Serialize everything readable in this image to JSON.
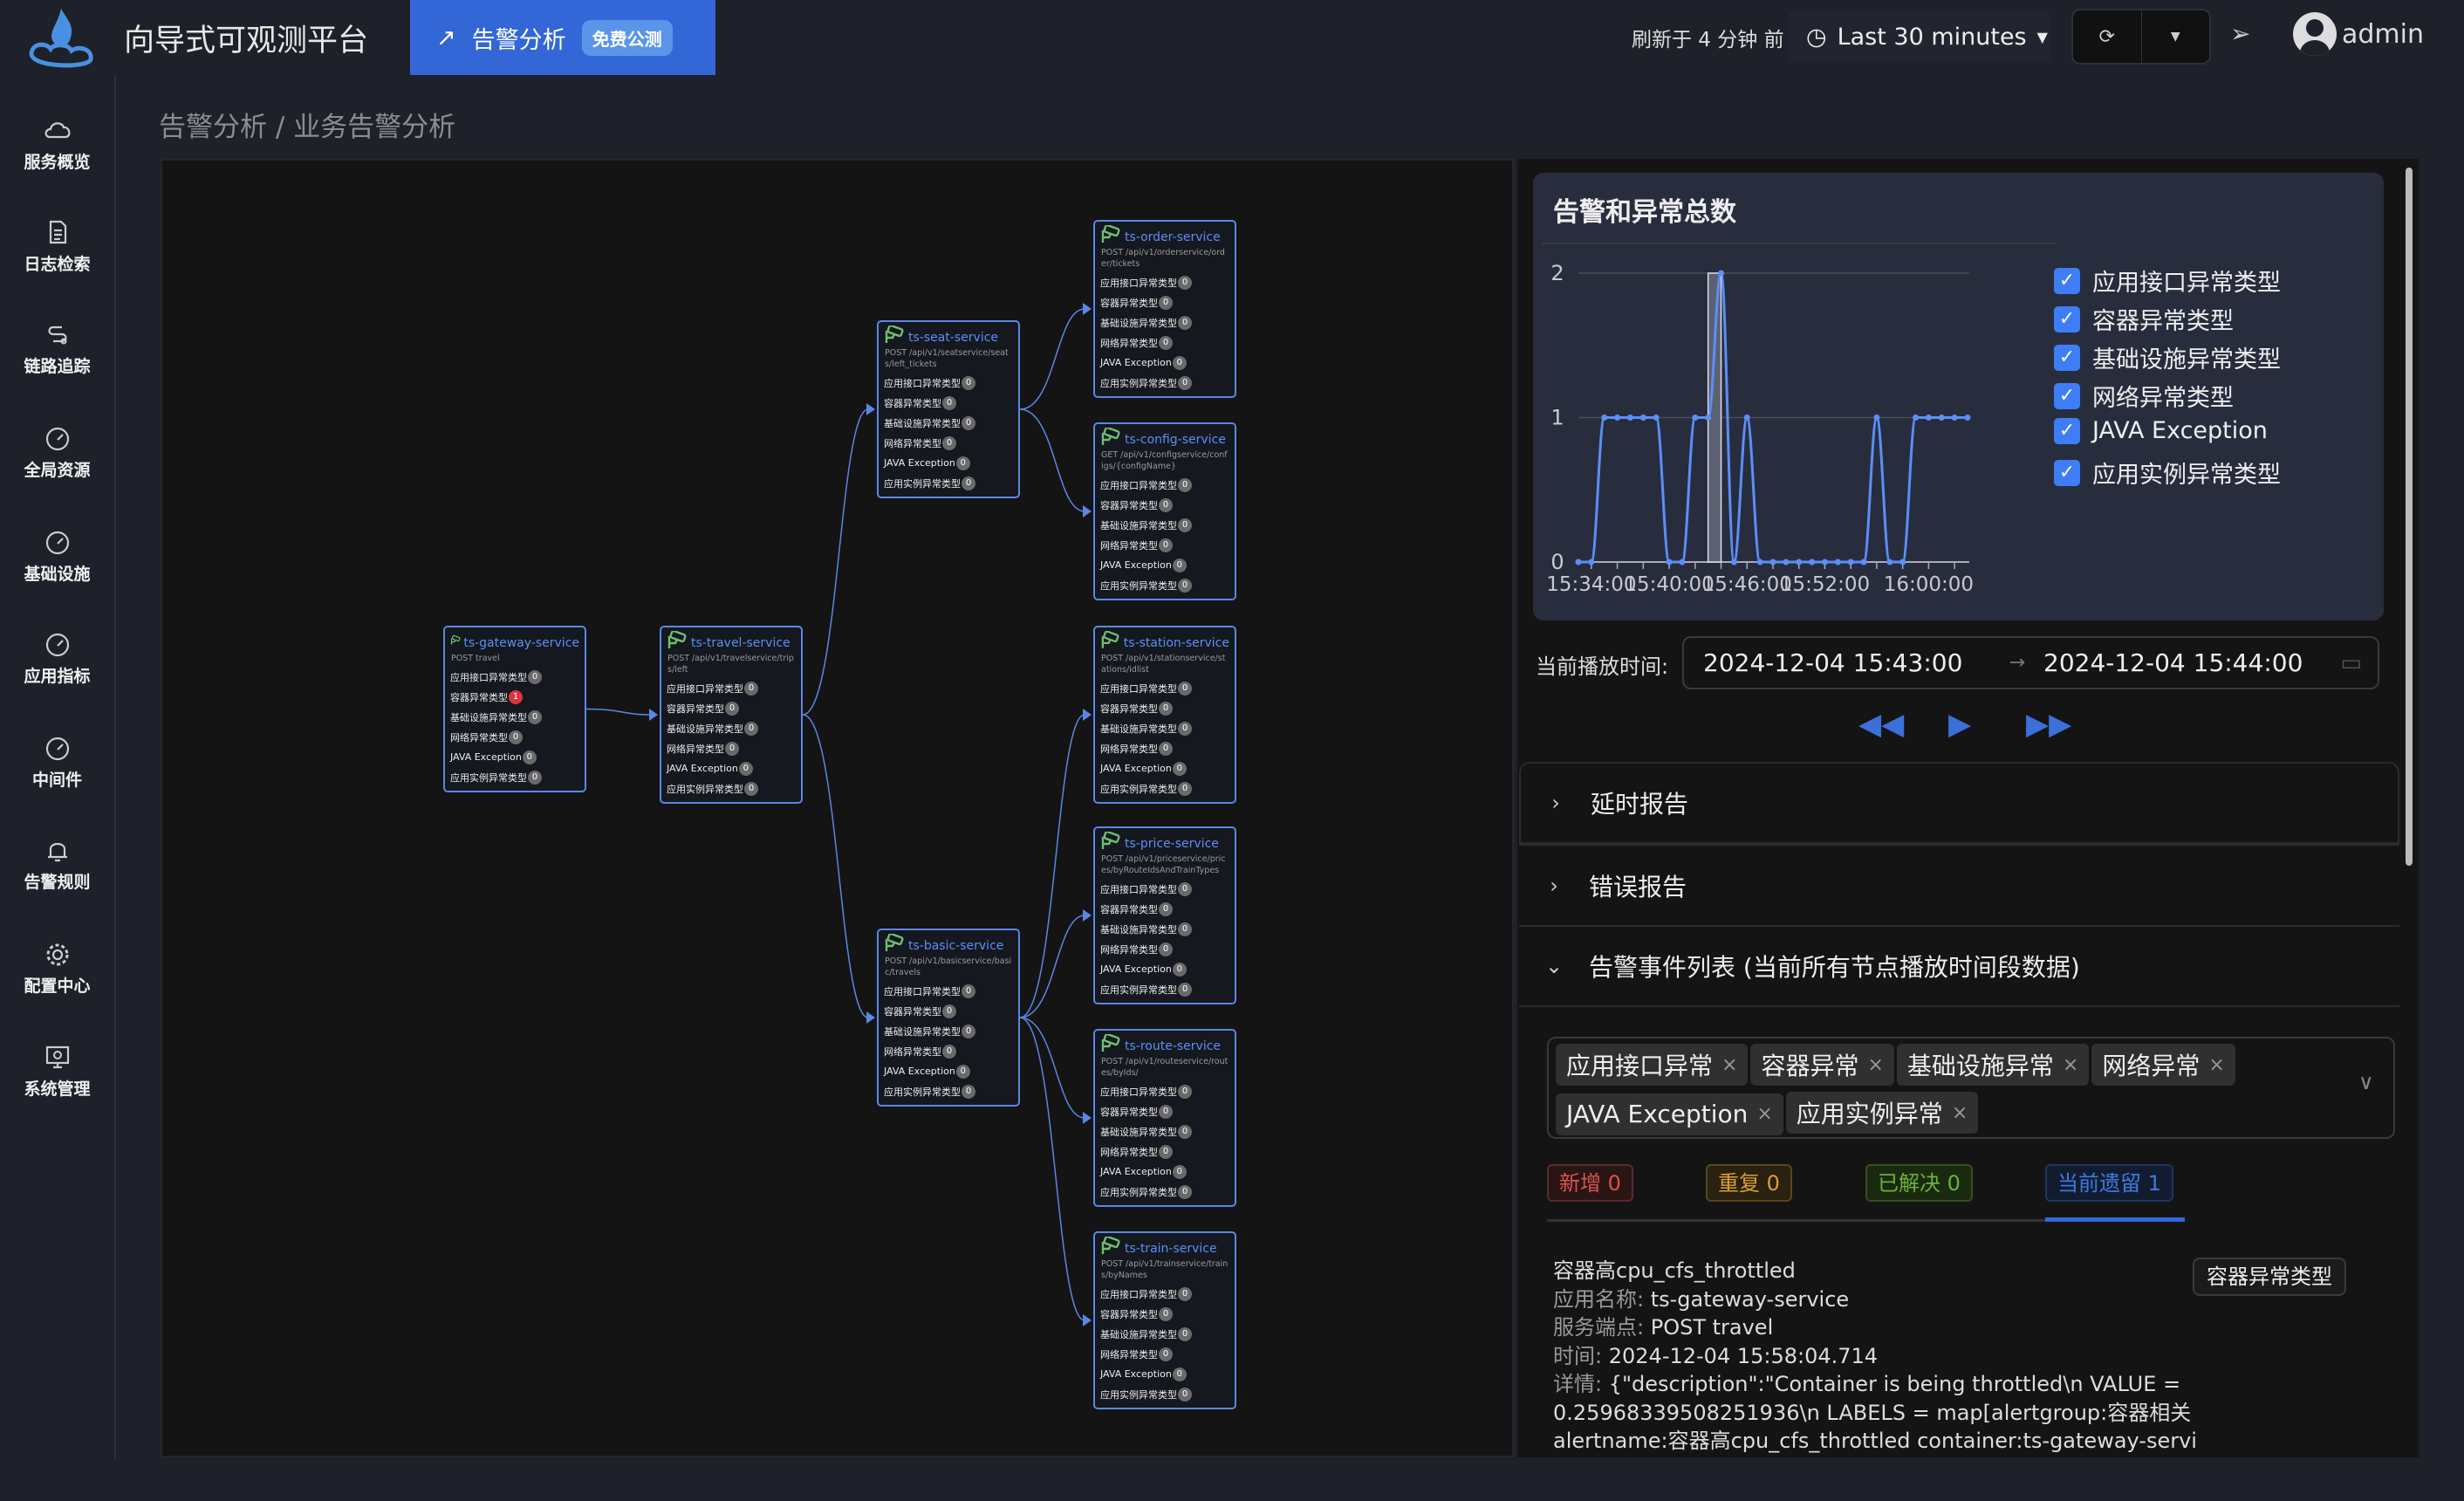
{
  "header": {
    "app_title": "向导式可观测平台",
    "active_tab": "告警分析",
    "beta_badge": "免费公测",
    "refresh_text": "刷新于 4 分钟 前",
    "time_range": "Last 30 minutes",
    "user": "admin"
  },
  "sidebar": {
    "items": [
      {
        "label": "服务概览",
        "icon": "cloud-icon"
      },
      {
        "label": "日志检索",
        "icon": "document-icon"
      },
      {
        "label": "链路追踪",
        "icon": "trace-icon"
      },
      {
        "label": "全局资源",
        "icon": "gauge-icon"
      },
      {
        "label": "基础设施",
        "icon": "gauge-icon"
      },
      {
        "label": "应用指标",
        "icon": "gauge-icon"
      },
      {
        "label": "中间件",
        "icon": "gauge-icon"
      },
      {
        "label": "告警规则",
        "icon": "bell-icon"
      },
      {
        "label": "配置中心",
        "icon": "gear-icon"
      },
      {
        "label": "系统管理",
        "icon": "monitor-gear-icon"
      }
    ]
  },
  "breadcrumb": "告警分析  /  业务告警分析",
  "graph": {
    "row_labels": [
      "应用接口异常类型",
      "容器异常类型",
      "基础设施异常类型",
      "网络异常类型",
      "JAVA Exception",
      "应用实例异常类型"
    ],
    "nodes": [
      {
        "id": "gateway",
        "name": "ts-gateway-service",
        "endpoint": "POST travel",
        "counts": [
          0,
          1,
          0,
          0,
          0,
          0
        ]
      },
      {
        "id": "travel",
        "name": "ts-travel-service",
        "endpoint": "POST /api/v1/travelservice/trips/left",
        "counts": [
          0,
          0,
          0,
          0,
          0,
          0
        ]
      },
      {
        "id": "seat",
        "name": "ts-seat-service",
        "endpoint": "POST /api/v1/seatservice/seats/left_tickets",
        "counts": [
          0,
          0,
          0,
          0,
          0,
          0
        ]
      },
      {
        "id": "basic",
        "name": "ts-basic-service",
        "endpoint": "POST /api/v1/basicservice/basic/travels",
        "counts": [
          0,
          0,
          0,
          0,
          0,
          0
        ]
      },
      {
        "id": "order",
        "name": "ts-order-service",
        "endpoint": "POST /api/v1/orderservice/order/tickets",
        "counts": [
          0,
          0,
          0,
          0,
          0,
          0
        ]
      },
      {
        "id": "config",
        "name": "ts-config-service",
        "endpoint": "GET /api/v1/configservice/configs/{configName}",
        "counts": [
          0,
          0,
          0,
          0,
          0,
          0
        ]
      },
      {
        "id": "station",
        "name": "ts-station-service",
        "endpoint": "POST /api/v1/stationservice/stations/idlist",
        "counts": [
          0,
          0,
          0,
          0,
          0,
          0
        ]
      },
      {
        "id": "price",
        "name": "ts-price-service",
        "endpoint": "POST /api/v1/priceservice/prices/byRouteIdsAndTrainTypes",
        "counts": [
          0,
          0,
          0,
          0,
          0,
          0
        ]
      },
      {
        "id": "route",
        "name": "ts-route-service",
        "endpoint": "POST /api/v1/routeservice/routes/byIds/",
        "counts": [
          0,
          0,
          0,
          0,
          0,
          0
        ]
      },
      {
        "id": "train",
        "name": "ts-train-service",
        "endpoint": "POST /api/v1/trainservice/trains/byNames",
        "counts": [
          0,
          0,
          0,
          0,
          0,
          0
        ]
      }
    ],
    "edges": [
      [
        "gateway",
        "travel"
      ],
      [
        "travel",
        "seat"
      ],
      [
        "travel",
        "basic"
      ],
      [
        "seat",
        "order"
      ],
      [
        "seat",
        "config"
      ],
      [
        "basic",
        "station"
      ],
      [
        "basic",
        "price"
      ],
      [
        "basic",
        "route"
      ],
      [
        "basic",
        "train"
      ]
    ],
    "colors": {
      "edge": "#5b86e5",
      "alert": "#d9363e",
      "icon": "#6fbf73"
    }
  },
  "chart_data": {
    "type": "line",
    "title": "告警和异常总数",
    "x": [
      "15:33",
      "15:34",
      "15:35",
      "15:36",
      "15:37",
      "15:38",
      "15:39",
      "15:40",
      "15:41",
      "15:42",
      "15:43",
      "15:44",
      "15:45",
      "15:46",
      "15:47",
      "15:48",
      "15:49",
      "15:50",
      "15:51",
      "15:52",
      "15:53",
      "15:54",
      "15:55",
      "15:56",
      "15:57",
      "15:58",
      "15:59",
      "16:00",
      "16:01",
      "16:02",
      "16:03"
    ],
    "values": [
      0,
      0,
      1,
      1,
      1,
      1,
      1,
      0,
      0,
      1,
      1,
      2,
      0,
      1,
      0,
      0,
      0,
      0,
      0,
      0,
      0,
      0,
      0,
      1,
      0,
      0,
      1,
      1,
      1,
      1,
      1
    ],
    "x_tick_labels": [
      "15:34:00",
      "15:40:00",
      "15:46:00",
      "15:52:00",
      "16:00:00"
    ],
    "y_ticks": [
      0,
      1,
      2
    ],
    "ylim": [
      0,
      2
    ],
    "highlight": [
      "15:43",
      "15:44"
    ],
    "grid": true,
    "color": "#5b8ff9",
    "legend_position": "right",
    "legend": [
      "应用接口异常类型",
      "容器异常类型",
      "基础设施异常类型",
      "网络异常类型",
      "JAVA Exception",
      "应用实例异常类型"
    ]
  },
  "playback": {
    "label": "当前播放时间:",
    "start": "2024-12-04 15:43:00",
    "end": "2024-12-04 15:44:00"
  },
  "sections": {
    "latency": "延时报告",
    "error": "错误报告",
    "events": "告警事件列表 (当前所有节点播放时间段数据)"
  },
  "filter_tags": [
    "应用接口异常",
    "容器异常",
    "基础设施异常",
    "网络异常",
    "JAVA Exception",
    "应用实例异常"
  ],
  "status_tabs": {
    "new": "新增 0",
    "repeat": "重复 0",
    "resolved": "已解决 0",
    "remaining": "当前遗留 1"
  },
  "event": {
    "title": "容器高cpu_cfs_throttled",
    "app_label": "应用名称:",
    "app": "ts-gateway-service",
    "endpoint_label": "服务端点:",
    "endpoint": "POST travel",
    "time_label": "时间:",
    "time": "2024-12-04 15:58:04.714",
    "detail_label": "详情:",
    "detail": "{\"description\":\"Container is being throttled\\n VALUE = 0.25968339508251936\\n LABELS = map[alertgroup:容器相关 alertname:容器高cpu_cfs_throttled container:ts-gateway-service",
    "type_badge": "容器异常类型"
  }
}
